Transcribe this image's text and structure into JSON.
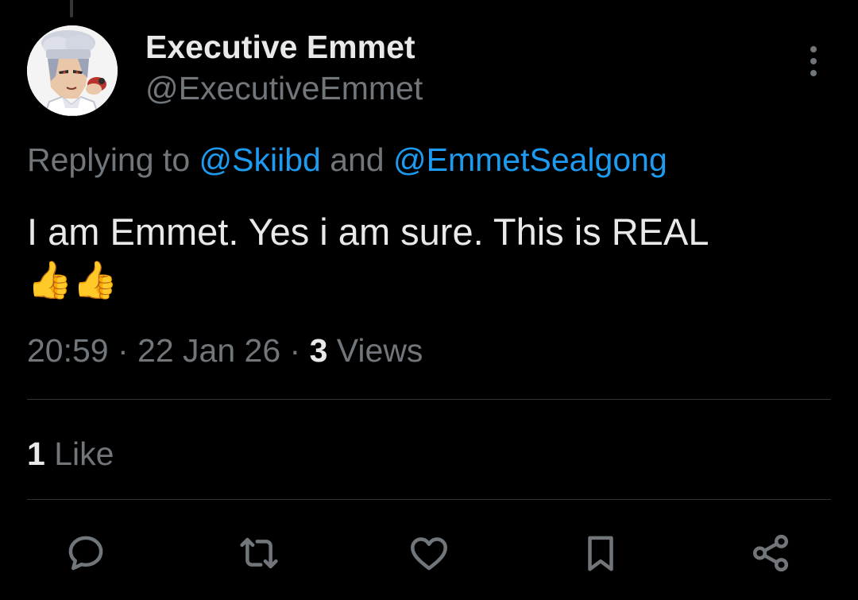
{
  "author": {
    "display_name": "Executive Emmet",
    "handle": "@ExecutiveEmmet",
    "avatar": "chef-character-avatar"
  },
  "reply": {
    "prefix": "Replying to ",
    "mention_1": "@Skiibd",
    "joiner": " and ",
    "mention_2": "@EmmetSealgong"
  },
  "tweet": {
    "text": "I am Emmet. Yes i am sure. This is REAL",
    "emoji": "👍👍"
  },
  "meta": {
    "time": "20:59",
    "sep1": " · ",
    "date": "22 Jan 26",
    "sep2": " · ",
    "views_count": "3",
    "views_label": " Views"
  },
  "engagement": {
    "likes_count": "1",
    "likes_label": " Like"
  },
  "actions": [
    {
      "name": "reply",
      "icon": "reply-icon"
    },
    {
      "name": "retweet",
      "icon": "retweet-icon"
    },
    {
      "name": "like",
      "icon": "heart-icon"
    },
    {
      "name": "bookmark",
      "icon": "bookmark-icon"
    },
    {
      "name": "share",
      "icon": "share-icon"
    }
  ],
  "colors": {
    "background": "#000000",
    "primary_text": "#e7e9ea",
    "secondary_text": "#71767b",
    "accent": "#1d9bf0",
    "divider": "#2f3336"
  }
}
